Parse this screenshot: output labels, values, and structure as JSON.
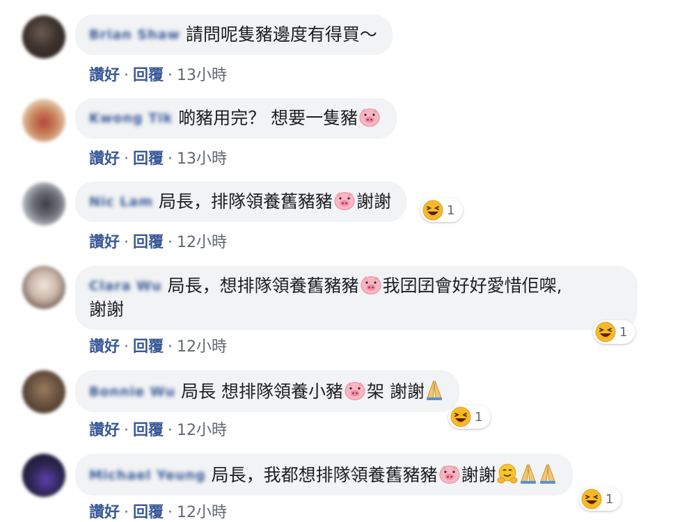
{
  "icons": {
    "pig": "pig-face-emoji",
    "haha": "laughing-face-emoji",
    "pray": "folded-hands-emoji",
    "hug": "hugging-face-emoji"
  },
  "colors": {
    "bubble": "#f2f3f5",
    "link": "#385898",
    "meta": "#606770",
    "haha": "#f7b928"
  },
  "comments": [
    {
      "author": "Brian Shaw",
      "text": "請問呢隻豬邊度有得買～",
      "like_label": "讚好",
      "reply_label": "回覆",
      "time": "13小時"
    },
    {
      "author": "Kwong Tik",
      "text_a": "啲豬用完？ 想要一隻豬",
      "like_label": "讚好",
      "reply_label": "回覆",
      "time": "13小時"
    },
    {
      "author": "Nic Lam",
      "text_a": "局長，排隊領養舊豬豬",
      "text_b": "謝謝",
      "reaction_count": "1",
      "like_label": "讚好",
      "reply_label": "回覆",
      "time": "12小時"
    },
    {
      "author": "Clara Wu",
      "text_a": "局長，想排隊領養舊豬豬",
      "text_b": "我囝囝會好好愛惜佢㗎,",
      "text_c": "謝謝",
      "reaction_count": "1",
      "like_label": "讚好",
      "reply_label": "回覆",
      "time": "12小時"
    },
    {
      "author": "Bonnie Wu",
      "text_a": "局長 想排隊領養小豬",
      "text_b": "架 謝謝",
      "reaction_count": "1",
      "like_label": "讚好",
      "reply_label": "回覆",
      "time": "12小時"
    },
    {
      "author": "Michael Yeung",
      "text_a": "局長，我都想排隊領養舊豬豬",
      "text_b": "謝謝",
      "reaction_count": "1",
      "like_label": "讚好",
      "reply_label": "回覆",
      "time": "12小時"
    }
  ]
}
